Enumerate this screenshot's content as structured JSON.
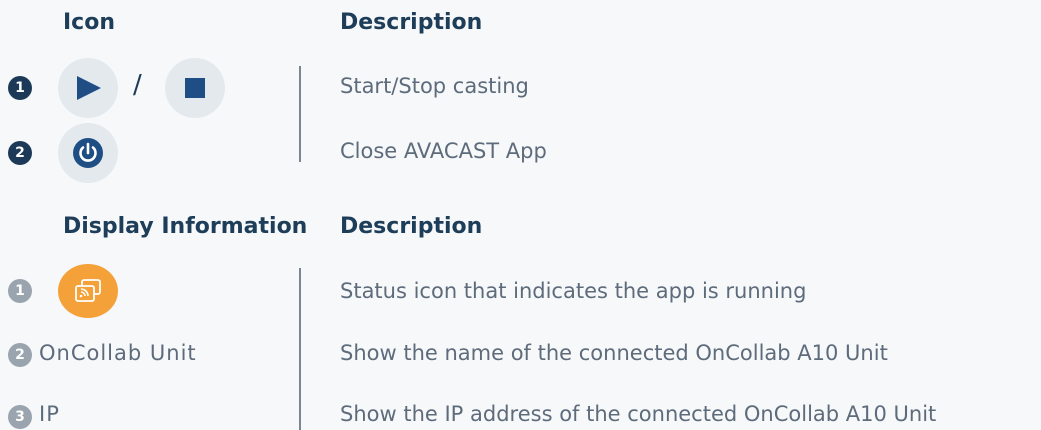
{
  "icon_table": {
    "header_icon": "Icon",
    "header_description": "Description",
    "rows": [
      {
        "number": "1",
        "icons": [
          "play-icon",
          "stop-icon"
        ],
        "separator": "/",
        "description": "Start/Stop casting"
      },
      {
        "number": "2",
        "icons": [
          "power-icon"
        ],
        "description": "Close AVACAST App"
      }
    ]
  },
  "info_table": {
    "header_info": "Display Information",
    "header_description": "Description",
    "rows": [
      {
        "number": "1",
        "icon": "cast-status-icon",
        "description": "Status icon that indicates the app is running"
      },
      {
        "number": "2",
        "label": "OnCollab Unit",
        "description": "Show the name of the connected OnCollab A10 Unit"
      },
      {
        "number": "3",
        "label": "IP",
        "description": "Show the IP address of the connected OnCollab A10 Unit"
      }
    ]
  },
  "colors": {
    "accent_dark": "#1c3a57",
    "icon_blue": "#1f4e85",
    "status_orange": "#f5a13a",
    "icon_bg": "#e4e9ee"
  }
}
